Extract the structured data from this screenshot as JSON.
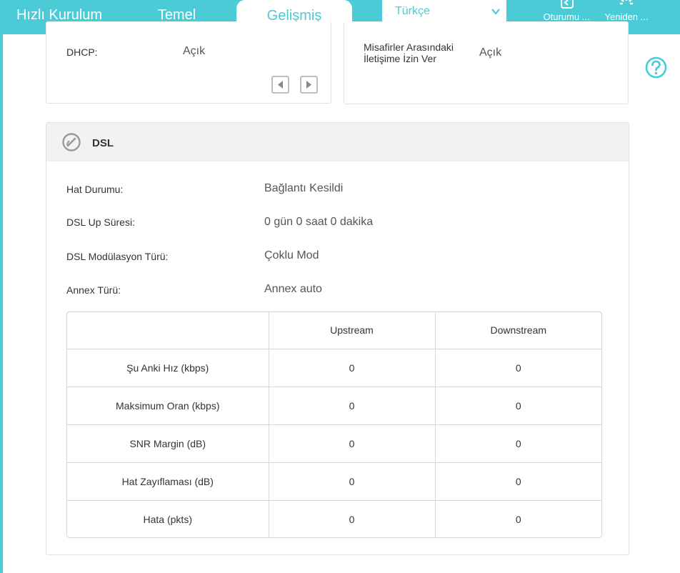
{
  "nav": {
    "quick_setup": "Hızlı Kurulum",
    "basic": "Temel",
    "advanced": "Gelişmiş",
    "language": "Türkçe",
    "logout": "Oturumu ...",
    "reboot": "Yeniden ..."
  },
  "upper_left_card": {
    "label": "DHCP:",
    "value": "Açık"
  },
  "upper_right_card": {
    "label_line1": "Misafirler Arasındaki",
    "label_line2": "İletişime İzin Ver",
    "value": "Açık"
  },
  "dsl": {
    "title": "DSL",
    "rows": [
      {
        "label": "Hat Durumu:",
        "value": "Bağlantı Kesildi"
      },
      {
        "label": "DSL Up Süresi:",
        "value": "0 gün 0 saat 0 dakika"
      },
      {
        "label": "DSL Modülasyon Türü:",
        "value": "Çoklu Mod"
      },
      {
        "label": "Annex Türü:",
        "value": "Annex auto"
      }
    ],
    "table": {
      "headers": [
        "",
        "Upstream",
        "Downstream"
      ],
      "rows": [
        [
          "Şu Anki Hız (kbps)",
          "0",
          "0"
        ],
        [
          "Maksimum Oran (kbps)",
          "0",
          "0"
        ],
        [
          "SNR Margin (dB)",
          "0",
          "0"
        ],
        [
          "Hat Zayıflaması (dB)",
          "0",
          "0"
        ],
        [
          "Hata (pkts)",
          "0",
          "0"
        ]
      ]
    }
  },
  "colors": {
    "accent": "#4acbd6",
    "panel_header": "#f2f2f2",
    "border": "#e1e1e1"
  },
  "icons": {
    "logout": "logout-icon",
    "reboot": "reboot-icon",
    "help": "help-icon",
    "dsl": "dsl-phone-icon",
    "prev": "chevron-left-icon",
    "next": "chevron-right-icon",
    "dropdown": "chevron-down-icon"
  }
}
